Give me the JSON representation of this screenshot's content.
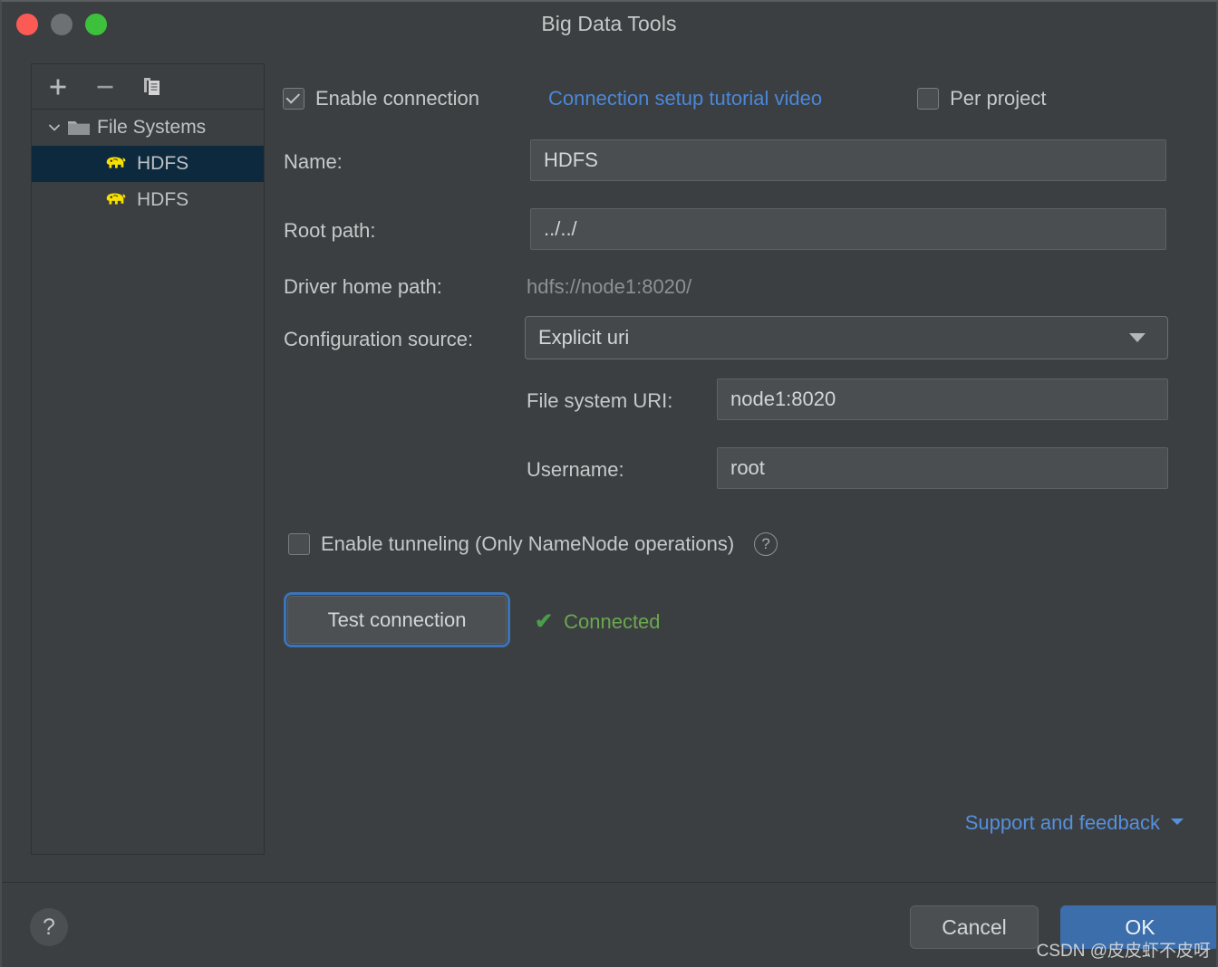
{
  "window": {
    "title": "Big Data Tools",
    "traffic_lights": [
      "close-button",
      "minimize-button",
      "maximize-button"
    ]
  },
  "sidebar": {
    "toolbar": [
      {
        "name": "add-button",
        "glyph": "+"
      },
      {
        "name": "remove-button",
        "glyph": "−"
      },
      {
        "name": "copy-button",
        "glyph": "copy-icon"
      }
    ],
    "tree": {
      "group_label": "File Systems",
      "group_icon": "folder-icon",
      "expanded_chevron": "chevron-down-icon",
      "items": [
        {
          "label": "HDFS",
          "icon": "hadoop-elephant-icon",
          "selected": true
        },
        {
          "label": "HDFS",
          "icon": "hadoop-elephant-icon",
          "selected": false
        }
      ]
    }
  },
  "form": {
    "enable_connection": {
      "label": "Enable connection",
      "checked": true
    },
    "tutorial_link": "Connection setup tutorial video",
    "per_project": {
      "label": "Per project",
      "checked": false
    },
    "name": {
      "label": "Name:",
      "value": "HDFS"
    },
    "root_path": {
      "label": "Root path:",
      "value": "../../"
    },
    "driver_home_path": {
      "label": "Driver home path:",
      "value": "hdfs://node1:8020/"
    },
    "configuration_source": {
      "label": "Configuration source:",
      "value": "Explicit uri",
      "caret": "chevron-down-icon"
    },
    "file_system_uri": {
      "label": "File system URI:",
      "value": "node1:8020"
    },
    "username": {
      "label": "Username:",
      "value": "root"
    },
    "enable_tunneling": {
      "label": "Enable tunneling (Only NameNode operations)",
      "checked": false,
      "help_icon": "help-circle-icon"
    },
    "test_connection_button": "Test connection",
    "connection_status": {
      "text": "Connected",
      "icon": "check-icon"
    },
    "support_link": {
      "text": "Support and feedback",
      "caret": "chevron-down-icon"
    }
  },
  "footer": {
    "help_button": "?",
    "cancel_button": "Cancel",
    "ok_button": "OK"
  },
  "watermark": "CSDN @皮皮虾不皮呀",
  "colors": {
    "window_bg": "#3c3f41",
    "selection_blue": "#0d293e",
    "link_blue": "#4a88d8",
    "accent_blue": "#3c6eab",
    "status_green": "#6aa84f",
    "hadoop_yellow": "#f7e000"
  }
}
